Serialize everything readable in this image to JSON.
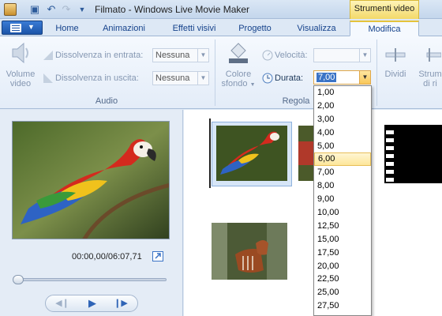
{
  "window": {
    "title": "Filmato - Windows Live Movie Maker",
    "context_tab_header": "Strumenti video"
  },
  "tabs": [
    {
      "label": "Home"
    },
    {
      "label": "Animazioni"
    },
    {
      "label": "Effetti visivi"
    },
    {
      "label": "Progetto"
    },
    {
      "label": "Visualizza"
    },
    {
      "label": "Modifica",
      "active": true
    }
  ],
  "ribbon": {
    "audio": {
      "group_label": "Audio",
      "volume_label_1": "Volume",
      "volume_label_2": "video",
      "fade_in_label": "Dissolvenza in entrata:",
      "fade_in_value": "Nessuna",
      "fade_out_label": "Dissolvenza in uscita:",
      "fade_out_value": "Nessuna"
    },
    "regola": {
      "group_label": "Regola",
      "bg_color_label_1": "Colore",
      "bg_color_label_2": "sfondo",
      "speed_label": "Velocità:",
      "speed_value": "",
      "duration_label": "Durata:",
      "duration_value": "7,00"
    },
    "split_label": "Dividi",
    "trim_label_1": "Strum",
    "trim_label_2": "di ri"
  },
  "player": {
    "timecode": "00:00,00/06:07,71",
    "position_fraction": 0.0
  },
  "duration_options": [
    "1,00",
    "2,00",
    "3,00",
    "4,00",
    "5,00",
    "6,00",
    "7,00",
    "8,00",
    "9,00",
    "10,00",
    "12,50",
    "15,00",
    "17,50",
    "20,00",
    "22,50",
    "25,00",
    "27,50"
  ],
  "duration_highlighted": "6,00",
  "colors": {
    "accent": "#3b74c6",
    "context_tab": "#f3d96a",
    "highlight": "#fde69a"
  }
}
